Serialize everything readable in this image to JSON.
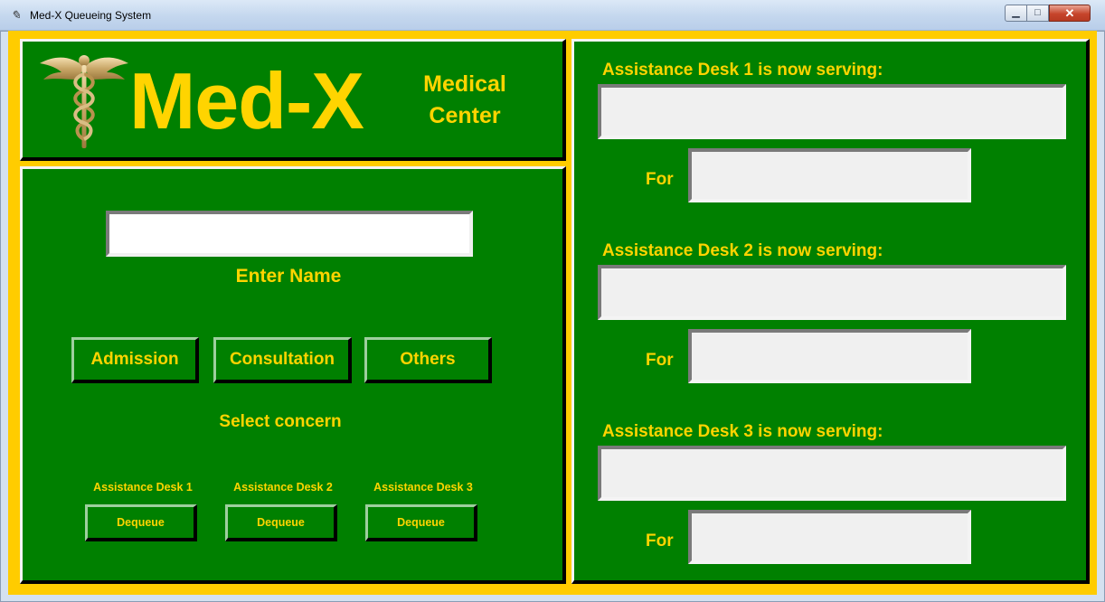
{
  "window": {
    "title": "Med-X Queueing System",
    "minimize_glyph": "▁",
    "maximize_glyph": "□",
    "close_glyph": "✕",
    "app_icon_glyph": "✎"
  },
  "brand": {
    "name": "Med-X",
    "subtitle_line1": "Medical",
    "subtitle_line2": "Center",
    "logo_icon": "caduceus-icon"
  },
  "form": {
    "name_value": "",
    "name_label": "Enter Name",
    "concerns": [
      "Admission",
      "Consultation",
      "Others"
    ],
    "concern_label": "Select concern",
    "desks": [
      {
        "caption": "Assistance Desk 1",
        "button": "Dequeue"
      },
      {
        "caption": "Assistance Desk 2",
        "button": "Dequeue"
      },
      {
        "caption": "Assistance Desk 3",
        "button": "Dequeue"
      }
    ]
  },
  "display": {
    "desks": [
      {
        "label": "Assistance Desk 1 is now serving:",
        "serving": "",
        "for_label": "For",
        "for_value": ""
      },
      {
        "label": "Assistance Desk 2 is now serving:",
        "serving": "",
        "for_label": "For",
        "for_value": ""
      },
      {
        "label": "Assistance Desk 3 is now serving:",
        "serving": "",
        "for_label": "For",
        "for_value": ""
      }
    ]
  },
  "colors": {
    "panel_green": "#008000",
    "text_yellow": "#ffd400",
    "frame_yellow": "#ffcc00"
  }
}
